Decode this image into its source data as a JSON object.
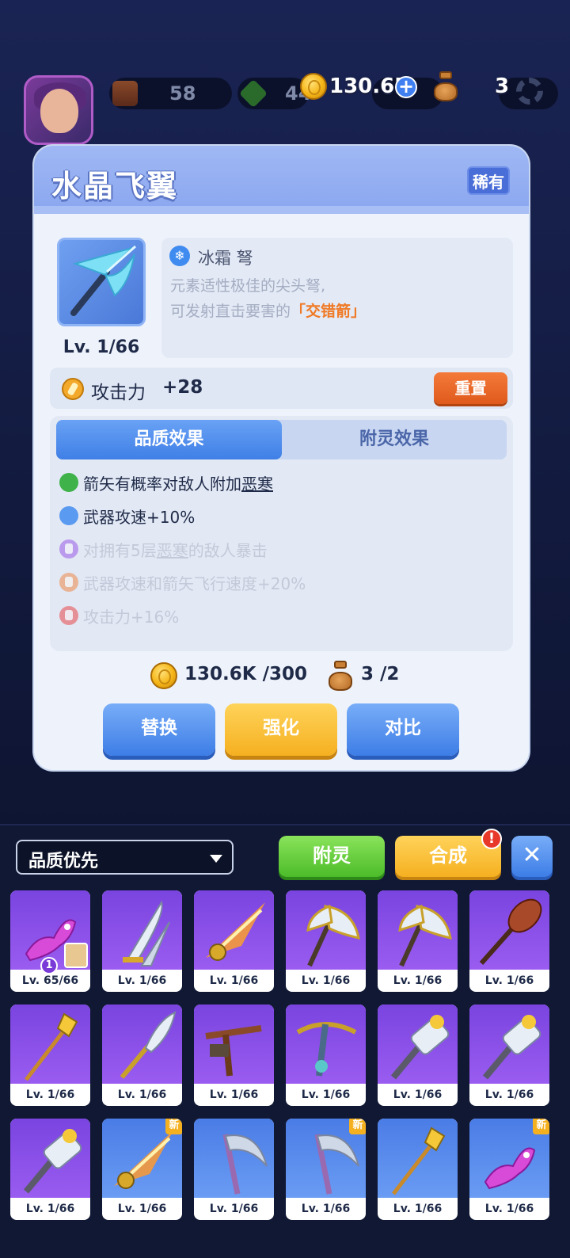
{
  "hud": {
    "food_count": "58",
    "gem_count": "44",
    "gold": "130.6K",
    "bags": "3"
  },
  "item": {
    "name": "水晶飞翼",
    "rarity": "稀有",
    "level": "Lv. 1/66",
    "element": "冰霜 弩",
    "desc_line1": "元素适性极佳的尖头弩,",
    "desc_line2_prefix": "可发射直击要害的",
    "desc_line2_highlight": "「交错箭」",
    "attack_label": "攻击力",
    "attack_value": "+28",
    "reset_label": "重置"
  },
  "tabs": {
    "quality": "品质效果",
    "enchant": "附灵效果"
  },
  "effects": [
    {
      "pre": "箭矢有概率对敌人附加",
      "u": "恶寒",
      "post": "",
      "color": "#3fb24a",
      "locked": false
    },
    {
      "pre": "武器攻速+10%",
      "u": "",
      "post": "",
      "color": "#5a9af0",
      "locked": false
    },
    {
      "pre": "对拥有5层",
      "u": "恶寒",
      "post": "的敌人暴击",
      "color": "#9a5ce8",
      "locked": true
    },
    {
      "pre": "武器攻速和箭矢飞行速度+20%",
      "u": "",
      "post": "",
      "color": "#f08a4a",
      "locked": true
    },
    {
      "pre": "攻击力+16%",
      "u": "",
      "post": "",
      "color": "#e84a4a",
      "locked": true
    }
  ],
  "cost": {
    "gold": "130.6K /300",
    "bags": "3 /2"
  },
  "actions": {
    "replace": "替换",
    "upgrade": "强化",
    "compare": "对比"
  },
  "inventory": {
    "sort_label": "品质优先",
    "enchant_btn": "附灵",
    "merge_btn": "合成",
    "alert": "!",
    "close": "✕",
    "new_tag": "新",
    "badge_num": "1",
    "items": [
      {
        "level": "Lv. 65/66",
        "art": "dragon",
        "bg": "purple",
        "new": false
      },
      {
        "level": "Lv. 1/66",
        "art": "blades",
        "bg": "purple",
        "new": false
      },
      {
        "level": "Lv. 1/66",
        "art": "fire",
        "bg": "purple",
        "new": false
      },
      {
        "level": "Lv. 1/66",
        "art": "axe",
        "bg": "purple",
        "new": false
      },
      {
        "level": "Lv. 1/66",
        "art": "axe",
        "bg": "purple",
        "new": false
      },
      {
        "level": "Lv. 1/66",
        "art": "club",
        "bg": "purple",
        "new": false
      },
      {
        "level": "Lv. 1/66",
        "art": "spear",
        "bg": "purple",
        "new": false
      },
      {
        "level": "Lv. 1/66",
        "art": "dagger",
        "bg": "purple",
        "new": false
      },
      {
        "level": "Lv. 1/66",
        "art": "xbow",
        "bg": "purple",
        "new": false
      },
      {
        "level": "Lv. 1/66",
        "art": "xbow2",
        "bg": "purple",
        "new": false
      },
      {
        "level": "Lv. 1/66",
        "art": "hammer",
        "bg": "purple",
        "new": false
      },
      {
        "level": "Lv. 1/66",
        "art": "hammer",
        "bg": "purple",
        "new": false
      },
      {
        "level": "Lv. 1/66",
        "art": "hammer",
        "bg": "purple",
        "new": false
      },
      {
        "level": "Lv. 1/66",
        "art": "fire",
        "bg": "blue2",
        "new": true
      },
      {
        "level": "Lv. 1/66",
        "art": "scythe",
        "bg": "blue2",
        "new": false
      },
      {
        "level": "Lv. 1/66",
        "art": "scythe",
        "bg": "blue2",
        "new": true
      },
      {
        "level": "Lv. 1/66",
        "art": "spear",
        "bg": "blue2",
        "new": false
      },
      {
        "level": "Lv. 1/66",
        "art": "dragon",
        "bg": "blue2",
        "new": true
      }
    ]
  }
}
